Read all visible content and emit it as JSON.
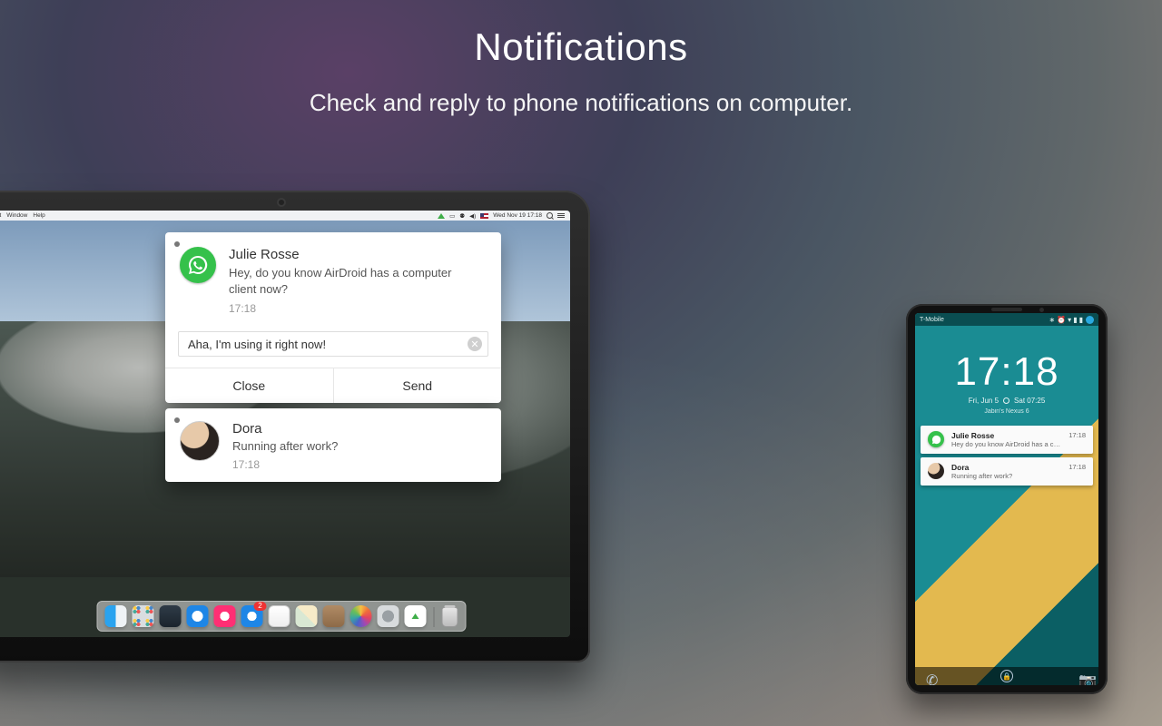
{
  "hero": {
    "title": "Notifications",
    "subtitle": "Check and reply to phone notifications on computer."
  },
  "mac_menubar": {
    "left_items": [
      "it",
      "Window",
      "Help"
    ],
    "clock": "Wed Nov 19 17:18"
  },
  "laptop_notif1": {
    "sender": "Julie Rosse",
    "message": "Hey, do you know AirDroid has a computer client now?",
    "time": "17:18",
    "reply_value": "Aha, I'm using it right now!",
    "btn_close": "Close",
    "btn_send": "Send"
  },
  "laptop_notif2": {
    "sender": "Dora",
    "message": "Running after work?",
    "time": "17:18"
  },
  "phone": {
    "carrier": "T-Mobile",
    "clock": "17:18",
    "date_left": "Fri, Jun 5",
    "date_right": "Sat 07:25",
    "device": "Jabin's Nexus 6",
    "card1": {
      "title": "Julie Rosse",
      "msg": "Hey do you know AirDroid has a comp...",
      "time": "17:18"
    },
    "card2": {
      "title": "Dora",
      "msg": "Running after work?",
      "time": "17:18"
    }
  }
}
